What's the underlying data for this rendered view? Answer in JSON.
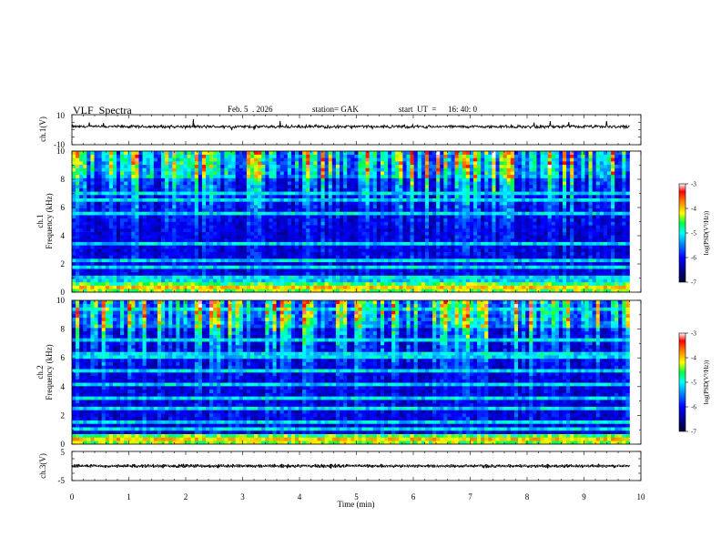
{
  "header": {
    "title": "VLF  Spectra",
    "date": "Feb. 5  . 2026",
    "station": "station= GAK",
    "start_ut_label": "start  UT  =",
    "start_ut_value": "16: 40: 0"
  },
  "colors": {
    "waveform": "#000000",
    "colormap": [
      "#000033",
      "#000080",
      "#0000ff",
      "#0080ff",
      "#00ffff",
      "#00ff80",
      "#ffff00",
      "#ff8000",
      "#ff0000",
      "#ffffff"
    ]
  },
  "chart_data": [
    {
      "type": "line",
      "name": "ch1-waveform",
      "ylabel": "ch.1(V)",
      "ylim": [
        -10,
        10
      ],
      "yticks": [
        "10",
        "-10"
      ],
      "xlim": [
        0,
        10
      ],
      "approx_level": 2.0,
      "approx_variation": 1.2
    },
    {
      "type": "heatmap",
      "name": "ch1-spectrogram",
      "ylabel": "ch.1\nFrequency  (kHz)",
      "ylim": [
        0,
        10
      ],
      "yticks": [
        "0",
        "2",
        "4",
        "6",
        "8",
        "10"
      ],
      "xlim": [
        0,
        10
      ],
      "data_extent_min": 9.8,
      "colorbar": {
        "label": "log(PSD(V²/Hz))",
        "range": [
          -7,
          -3
        ],
        "ticks": [
          "-3",
          "-4",
          "-5",
          "-6",
          "-7"
        ]
      },
      "bands_khz": [
        0.2,
        0.5,
        0.8,
        1.1,
        1.7,
        2.3,
        3.4,
        5.7,
        6.6,
        7.1
      ]
    },
    {
      "type": "heatmap",
      "name": "ch2-spectrogram",
      "ylabel": "ch.2\nFrequency  (kHz)",
      "ylim": [
        0,
        10
      ],
      "yticks": [
        "0",
        "2",
        "4",
        "6",
        "8",
        "10"
      ],
      "xlim": [
        0,
        10
      ],
      "data_extent_min": 9.8,
      "colorbar": {
        "label": "log(PSD(V²/Hz))",
        "range": [
          -7,
          -3
        ],
        "ticks": [
          "-3",
          "-4",
          "-5",
          "-6",
          "-7"
        ]
      },
      "bands_khz": [
        0.2,
        0.6,
        1.0,
        1.6,
        2.6,
        3.3,
        4.1,
        5.0,
        6.0,
        6.3,
        7.2,
        9.5
      ]
    },
    {
      "type": "line",
      "name": "ch3-waveform",
      "ylabel": "ch.3(V)",
      "ylim": [
        -5,
        5
      ],
      "yticks": [
        "5",
        "-5"
      ],
      "xlim": [
        0,
        10
      ],
      "approx_level": 0.0,
      "approx_variation": 0.3
    }
  ],
  "xaxis": {
    "label": "Time  (min)",
    "ticks": [
      "0",
      "1",
      "2",
      "3",
      "4",
      "5",
      "6",
      "7",
      "8",
      "9",
      "10"
    ]
  }
}
